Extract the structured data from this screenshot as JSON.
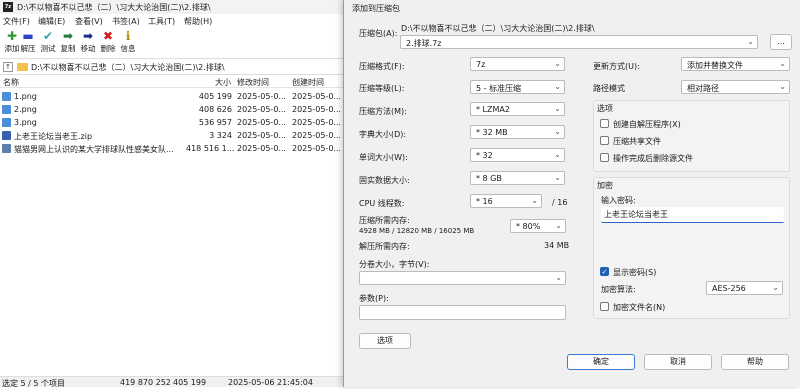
{
  "file_manager": {
    "app_icon": "7z",
    "title": "D:\\不以物喜不以己悲（二）\\习大大论治国(二)\\2.排球\\",
    "menu": [
      "文件(F)",
      "编辑(E)",
      "查看(V)",
      "书签(A)",
      "工具(T)",
      "帮助(H)"
    ],
    "toolbar": [
      {
        "label": "添加",
        "icon": "plus-icon",
        "glyph": "✚",
        "color": "#2e9e2e"
      },
      {
        "label": "解压",
        "icon": "minus-icon",
        "glyph": "▬",
        "color": "#2a44c8"
      },
      {
        "label": "测试",
        "icon": "check-icon",
        "glyph": "✔",
        "color": "#2aa6a6"
      },
      {
        "label": "复制",
        "icon": "arrow-right-icon",
        "glyph": "➡",
        "color": "#1f7a3a"
      },
      {
        "label": "移动",
        "icon": "move-arrow-icon",
        "glyph": "➡",
        "color": "#1a2a8a"
      },
      {
        "label": "删除",
        "icon": "delete-x-icon",
        "glyph": "✖",
        "color": "#d22020"
      },
      {
        "label": "信息",
        "icon": "info-icon",
        "glyph": "ℹ",
        "color": "#b08a10"
      }
    ],
    "address": "D:\\不以物喜不以己悲（二）\\习大大论治国(二)\\2.排球\\",
    "columns": {
      "name": "名称",
      "size": "大小",
      "modified": "修改时间",
      "created": "创建时间"
    },
    "files": [
      {
        "name": "1.png",
        "size": "405 199",
        "modified": "2025-05-0...",
        "created": "2025-05-0...",
        "icon": "image-file-icon",
        "color": "#4a90d9"
      },
      {
        "name": "2.png",
        "size": "408 626",
        "modified": "2025-05-0...",
        "created": "2025-05-0...",
        "icon": "image-file-icon",
        "color": "#4a90d9"
      },
      {
        "name": "3.png",
        "size": "536 957",
        "modified": "2025-05-0...",
        "created": "2025-05-0...",
        "icon": "image-file-icon",
        "color": "#4a90d9"
      },
      {
        "name": "上老王论坛当老王.zip",
        "size": "3 324",
        "modified": "2025-05-0...",
        "created": "2025-05-0...",
        "icon": "zip-file-icon",
        "color": "#3b5fb0"
      },
      {
        "name": "猫猫男网上认识的某大学排球队性感美女队...",
        "size": "418 516 1...",
        "modified": "2025-05-0...",
        "created": "2025-05-0...",
        "icon": "video-file-icon",
        "color": "#5a7fa8"
      }
    ],
    "status": {
      "selection": "选定 5 / 5 个项目",
      "total": "419 870 252",
      "selected_size": "405 199",
      "date": "2025-05-06 21:45:04"
    }
  },
  "dialog": {
    "title": "添加到压缩包",
    "archive_label": "压缩包(A):",
    "archive_path": "D:\\不以物喜不以己悲（二）\\习大大论治国(二)\\2.排球\\",
    "archive_name": "2.排球.7z",
    "browse_label": "...",
    "format_label": "压缩格式(F):",
    "format_value": "7z",
    "level_label": "压缩等级(L):",
    "level_value": "5 - 标准压缩",
    "method_label": "压缩方法(M):",
    "method_value": "* LZMA2",
    "dict_label": "字典大小(D):",
    "dict_value": "* 32 MB",
    "word_label": "单词大小(W):",
    "word_value": "* 32",
    "solid_label": "固实数据大小:",
    "solid_value": "* 8 GB",
    "threads_label": "CPU 线程数:",
    "threads_value": "* 16",
    "threads_max": "/ 16",
    "mem_label": "压缩所需内存:",
    "mem_detail": "4928 MB / 12820 MB / 16025 MB",
    "mem_percent": "* 80%",
    "decomp_label": "解压所需内存:",
    "decomp_value": "34 MB",
    "split_label": "分卷大小，字节(V):",
    "params_label": "参数(P):",
    "options_button": "选项",
    "update_label": "更新方式(U):",
    "update_value": "添加并替换文件",
    "path_label": "路径模式",
    "path_value": "相对路径",
    "options_group": "选项",
    "opt_sfx": "创建自解压程序(X)",
    "opt_shared": "压缩共享文件",
    "opt_delete": "操作完成后删除源文件",
    "encrypt_group": "加密",
    "password_label": "输入密码:",
    "password_value": "上老王论坛当老王",
    "show_password": "显示密码(S)",
    "enc_method_label": "加密算法:",
    "enc_method_value": "AES-256",
    "encrypt_names": "加密文件名(N)",
    "ok_button": "确定",
    "cancel_button": "取消",
    "help_button": "帮助"
  }
}
